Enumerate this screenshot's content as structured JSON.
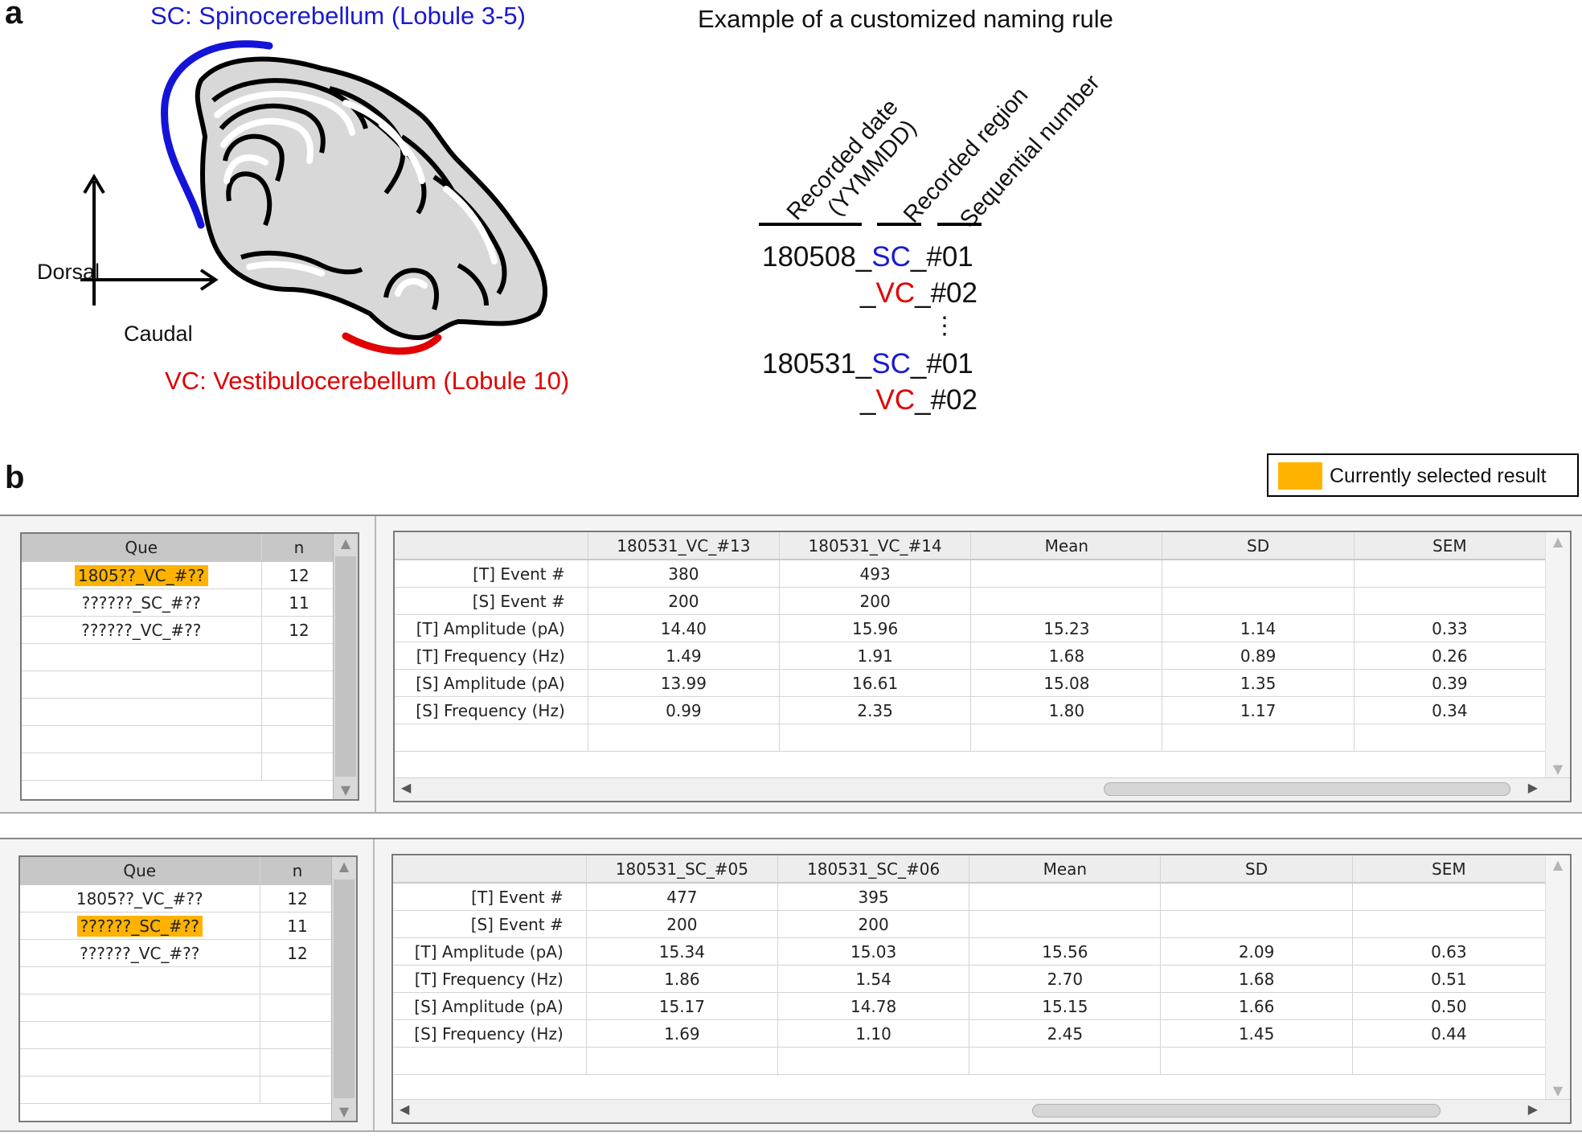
{
  "panel_a": {
    "letter": "a",
    "sc_label": "SC: Spinocerebellum (Lobule 3-5)",
    "vc_label": "VC: Vestibulocerebellum (Lobule 10)",
    "dorsal": "Dorsal",
    "caudal": "Caudal",
    "naming_title": "Example of a customized naming rule",
    "col_date_1": "Recorded date",
    "col_date_2": "(YYMMDD)",
    "col_region": "Recorded region",
    "col_seq": "Sequential number",
    "examples": [
      {
        "date": "180508",
        "sep1": "_",
        "region": "SC",
        "sep2": "_",
        "seq": "#01"
      },
      {
        "date": "",
        "sep1": "_",
        "region": "VC",
        "sep2": "_",
        "seq": "#02"
      },
      {
        "date": "180531",
        "sep1": "_",
        "region": "SC",
        "sep2": "_",
        "seq": "#01"
      },
      {
        "date": "",
        "sep1": "_",
        "region": "VC",
        "sep2": "_",
        "seq": "#02"
      }
    ],
    "ellipsis": "⋮",
    "colors": {
      "sc": "#1a1ad0",
      "vc": "#e00000"
    }
  },
  "panel_b": {
    "letter": "b",
    "legend": "Currently selected result",
    "legend_color": "#ffb300",
    "windows": [
      {
        "queue_header": [
          "Que",
          "n"
        ],
        "queue": [
          {
            "name": "1805??_VC_#??",
            "n": "12",
            "selected": true
          },
          {
            "name": "??????_SC_#??",
            "n": "11",
            "selected": false
          },
          {
            "name": "??????_VC_#??",
            "n": "12",
            "selected": false
          }
        ],
        "columns": [
          "",
          "180531_VC_#13",
          "180531_VC_#14",
          "Mean",
          "SD",
          "SEM"
        ],
        "rows": [
          [
            "[T] Event #",
            "380",
            "493",
            "",
            "",
            ""
          ],
          [
            "[S] Event #",
            "200",
            "200",
            "",
            "",
            ""
          ],
          [
            "[T] Amplitude (pA)",
            "14.40",
            "15.96",
            "15.23",
            "1.14",
            "0.33"
          ],
          [
            "[T] Frequency (Hz)",
            "1.49",
            "1.91",
            "1.68",
            "0.89",
            "0.26"
          ],
          [
            "[S] Amplitude (pA)",
            "13.99",
            "16.61",
            "15.08",
            "1.35",
            "0.39"
          ],
          [
            "[S] Frequency (Hz)",
            "0.99",
            "2.35",
            "1.80",
            "1.17",
            "0.34"
          ]
        ]
      },
      {
        "queue_header": [
          "Que",
          "n"
        ],
        "queue": [
          {
            "name": "1805??_VC_#??",
            "n": "12",
            "selected": false
          },
          {
            "name": "??????_SC_#??",
            "n": "11",
            "selected": true
          },
          {
            "name": "??????_VC_#??",
            "n": "12",
            "selected": false
          }
        ],
        "columns": [
          "",
          "180531_SC_#05",
          "180531_SC_#06",
          "Mean",
          "SD",
          "SEM"
        ],
        "rows": [
          [
            "[T] Event #",
            "477",
            "395",
            "",
            "",
            ""
          ],
          [
            "[S] Event #",
            "200",
            "200",
            "",
            "",
            ""
          ],
          [
            "[T] Amplitude (pA)",
            "15.34",
            "15.03",
            "15.56",
            "2.09",
            "0.63"
          ],
          [
            "[T] Frequency (Hz)",
            "1.86",
            "1.54",
            "2.70",
            "1.68",
            "0.51"
          ],
          [
            "[S] Amplitude (pA)",
            "15.17",
            "14.78",
            "15.15",
            "1.66",
            "0.50"
          ],
          [
            "[S] Frequency (Hz)",
            "1.69",
            "1.10",
            "2.45",
            "1.45",
            "0.44"
          ]
        ]
      }
    ]
  }
}
